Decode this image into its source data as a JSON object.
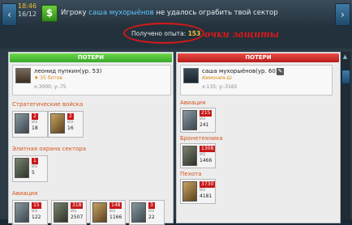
{
  "topbar": {
    "time": "18:46",
    "counter": "16/12",
    "dollar_icon": "$",
    "message_prefix": "Игроку",
    "message_player": "саша мухорыёнов",
    "message_suffix": "не удалось ограбить твой сектор",
    "nav_left": "‹",
    "nav_right": "›"
  },
  "experience": {
    "label": "Получено опыта:",
    "value": "153",
    "annotation": "очки защиты"
  },
  "left_panel": {
    "title": "ПОТЕРИ",
    "player": {
      "name": "леонид пупкин(ур. 53)",
      "sub": "♦ 35 ботов",
      "coords": "x:3000; y:-75"
    },
    "sections": [
      {
        "title": "Стратегические войска"
      },
      {
        "title": "Элитная охрана сектора"
      },
      {
        "title": "Авиация"
      }
    ],
    "strategic_units": [
      {
        "lost": "2",
        "iz": "из",
        "total": "18"
      },
      {
        "lost": "2",
        "iz": "из",
        "total": "16"
      }
    ],
    "elite_units": [
      {
        "lost": "1",
        "iz": "из",
        "total": "5"
      }
    ],
    "aviation_units": [
      {
        "lost": "15",
        "iz": "из",
        "total": "122"
      },
      {
        "lost": "318",
        "iz": "из",
        "total": "2507"
      },
      {
        "lost": "148",
        "iz": "из",
        "total": "1166"
      },
      {
        "lost": "3",
        "iz": "из",
        "total": "22"
      }
    ]
  },
  "right_panel": {
    "title": "ПОТЕРИ",
    "player": {
      "name": "саша мухорыёнов(ур. 60)",
      "sub": "Аммония-Ш",
      "coords": "x:135; y:-3165"
    },
    "sections": [
      {
        "title": "Авиация"
      },
      {
        "title": "Бронетехника"
      },
      {
        "title": "Пехота"
      }
    ],
    "aviation_units": [
      {
        "lost": "215",
        "iz": "из",
        "total": "241"
      }
    ],
    "armor_units": [
      {
        "lost": "1308",
        "iz": "из",
        "total": "1466"
      }
    ],
    "infantry_units": [
      {
        "lost": "3730",
        "iz": "из",
        "total": "4181"
      }
    ]
  },
  "icons": {
    "dollar": "dollar-icon",
    "edit": "pencil-icon"
  },
  "colors": {
    "accent_green": "#38a82a",
    "accent_red": "#c81818",
    "link_blue": "#5fc4ff",
    "annotation_red": "#e01818"
  }
}
